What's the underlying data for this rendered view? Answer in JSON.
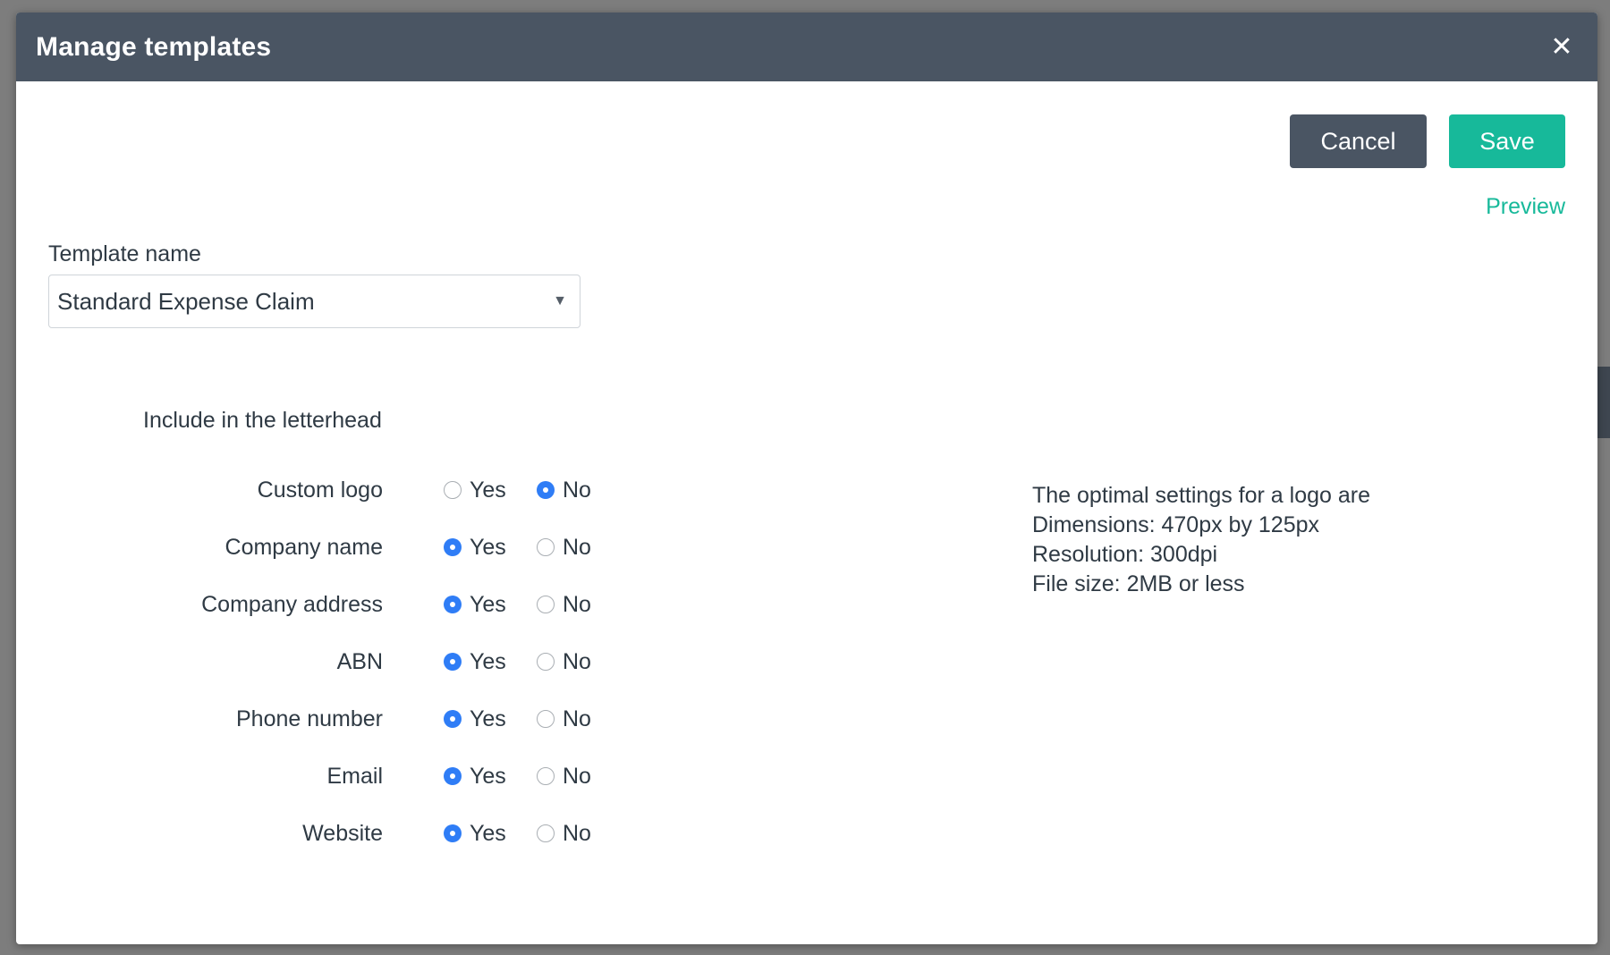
{
  "modal": {
    "title": "Manage templates",
    "close_icon": "close-icon"
  },
  "actions": {
    "cancel_label": "Cancel",
    "save_label": "Save",
    "preview_label": "Preview"
  },
  "template": {
    "label": "Template name",
    "selected": "Standard Expense Claim",
    "caret_icon": "caret-down-icon"
  },
  "letterhead": {
    "heading": "Include in the letterhead",
    "yes_label": "Yes",
    "no_label": "No",
    "options": [
      {
        "label": "Custom logo",
        "value": "No"
      },
      {
        "label": "Company name",
        "value": "Yes"
      },
      {
        "label": "Company address",
        "value": "Yes"
      },
      {
        "label": "ABN",
        "value": "Yes"
      },
      {
        "label": "Phone number",
        "value": "Yes"
      },
      {
        "label": "Email",
        "value": "Yes"
      },
      {
        "label": "Website",
        "value": "Yes"
      }
    ]
  },
  "logo_info": {
    "lines": [
      "The optimal settings for a logo are",
      "Dimensions: 470px by 125px",
      "Resolution: 300dpi",
      "File size: 2MB or less"
    ]
  },
  "colors": {
    "header_bg": "#4a5563",
    "accent": "#17b99a",
    "radio_checked": "#2f7df6"
  }
}
